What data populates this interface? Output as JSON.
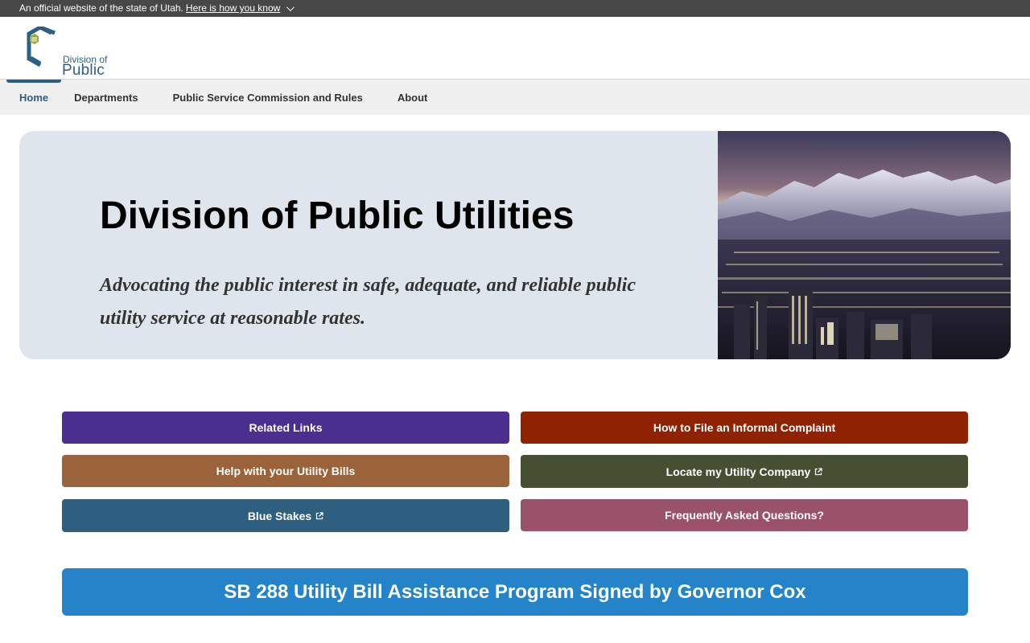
{
  "gov_banner": {
    "text": "An official website of the state of Utah.",
    "link": "Here is how you know"
  },
  "logo": {
    "line1": "Division of",
    "line2": "Public Utilities"
  },
  "nav": {
    "items": [
      "Home",
      "Departments",
      "Public Service Commission and Rules",
      "About"
    ],
    "active": "Home"
  },
  "hero": {
    "title": "Division of Public Utilities",
    "tagline": "Advocating the public interest in safe, adequate, and reliable public utility service at reasonable rates.",
    "image_alt": "Salt Lake City skyline at night with snowy mountains"
  },
  "buttons": [
    {
      "label": "Related Links",
      "color": "#4b2f8f",
      "external": false
    },
    {
      "label": "How to File an Informal Complaint",
      "color": "#8f2200",
      "external": false
    },
    {
      "label": "Help with your Utility Bills",
      "color": "#9a6339",
      "external": false
    },
    {
      "label": "Locate my Utility Company",
      "color": "#474f33",
      "external": true
    },
    {
      "label": "Blue Stakes",
      "color": "#2e5f80",
      "external": true
    },
    {
      "label": "Frequently Asked Questions?",
      "color": "#9a526b",
      "external": false
    }
  ],
  "announcement": {
    "text": "SB 288 Utility Bill Assistance Program Signed by Governor Cox",
    "color": "#2483c9"
  },
  "icons": {
    "chevron": "chevron-down-icon",
    "external": "external-link-icon",
    "logo": "hexagon-c-logo-icon"
  }
}
